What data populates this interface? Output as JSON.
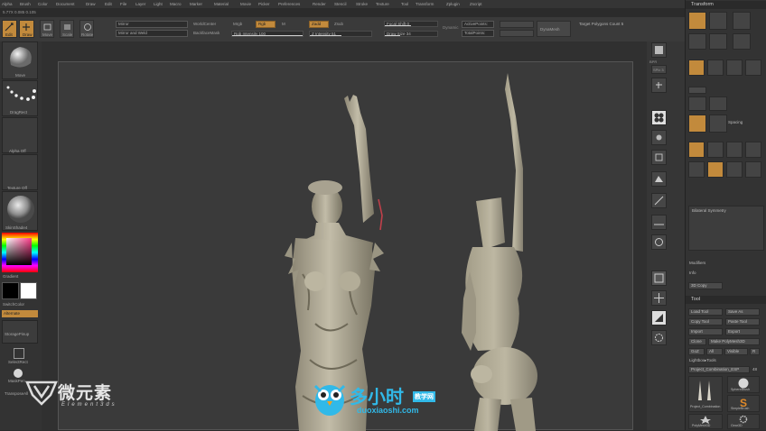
{
  "menu": {
    "items": [
      "Alpha",
      "Brush",
      "Color",
      "Document",
      "Draw",
      "Edit",
      "File",
      "Layer",
      "Light",
      "Macro",
      "Marker",
      "Material",
      "Movie",
      "Picker",
      "Preferences",
      "Render",
      "Stencil",
      "Stroke",
      "Texture",
      "Tool",
      "Transform",
      "Zplugin",
      "Zscript"
    ]
  },
  "status": {
    "text": "5.77X 0.085 0.105"
  },
  "topshelf": {
    "buttons": {
      "edit": "Edit",
      "draw": "Draw",
      "move": "Move",
      "scale": "Scale",
      "rotate": "Rotate"
    },
    "mirror_field": "Mirror",
    "mirror_weld_field": "Mirror and Weld",
    "world_center": "WorldCenter",
    "backface_mask": "BackfaceMask",
    "mrgb": "Mrgb",
    "rgb": "Rgb",
    "m": "M",
    "rgb_intensity": {
      "label": "Rgb Intensity",
      "value": "100"
    },
    "zadd": "Zadd",
    "zsub": "Zsub",
    "z_intensity": {
      "label": "Z Intensity",
      "value": "51"
    },
    "focal_shift": {
      "label": "Focal Shift",
      "value": "0"
    },
    "draw_size": {
      "label": "Draw Size",
      "value": "34"
    },
    "dynamic": "Dynamic",
    "active_points": "ActivePoints:",
    "total_points": "TotalPoints:",
    "dynamesh": "DynaMesh",
    "target_polygons": {
      "label": "Target Polygons Count",
      "value": "5"
    }
  },
  "leftshelf": {
    "brush_label": "Move",
    "stroke_label": "DragRect",
    "alpha_label": "Alpha Off",
    "texture_label": "Texture Off",
    "material_label": "SkinShade4",
    "gradient_label": "Gradient",
    "switch_color": "SwitchColor",
    "alternate": "Alternate",
    "doc_label": "StoragePinup",
    "selectrect": "SelectRect",
    "maskpen": "MaskPen",
    "transpose": "TransposeAll"
  },
  "rightshelf": {
    "labels": [
      "BPR",
      "SPix 3",
      "Scroll",
      "Zoom",
      "Actual",
      "AAHalf",
      "Dynamic",
      "Persp",
      "Floor",
      "Local",
      "L.Sym",
      "Frame",
      "Move",
      "Scale",
      "Rotate",
      "Line Fill",
      "PolyF",
      "Transp",
      "Ghost",
      "Solo",
      "Xpose"
    ]
  },
  "tray": {
    "transform_header": "Transform",
    "tool_header": "Tool",
    "bilateral_symmetry": "Bilateral Symmetry",
    "spacing": "Spacing",
    "info": "Info",
    "modifiers": "Modifiers",
    "copy_3d": "3D Copy",
    "buttons": {
      "load_tool": "Load Tool",
      "save_as": "Save As",
      "copy_tool": "Copy Tool",
      "paste_tool": "Paste Tool",
      "import": "Import",
      "export": "Export",
      "clone": "Clone",
      "make_polymesh": "Make PolyMesh3D",
      "goz": "GoZ",
      "all": "All",
      "visible": "Visible",
      "r": "R",
      "lightbox_tools": "Lightbox▸Tools",
      "project_tool": "Project_Combination_ESP",
      "count": "48"
    },
    "tools": [
      "Project_Combination",
      "SphereBrush",
      "SimpleBrush",
      "PolyMesh3D",
      "Gear3D"
    ]
  },
  "watermark": {
    "left_brand": "微元素",
    "left_sub": "Element3ds",
    "right_brand": "多小时",
    "right_tag": "教学网",
    "right_url": "duoxiaoshi.com"
  },
  "colors": {
    "accent": "#c28a3c",
    "background": "#2b2b2b",
    "viewport": "#3a3a3a",
    "sculpt": "#b9b3a0",
    "watermark_cyan": "#31b9e8"
  }
}
